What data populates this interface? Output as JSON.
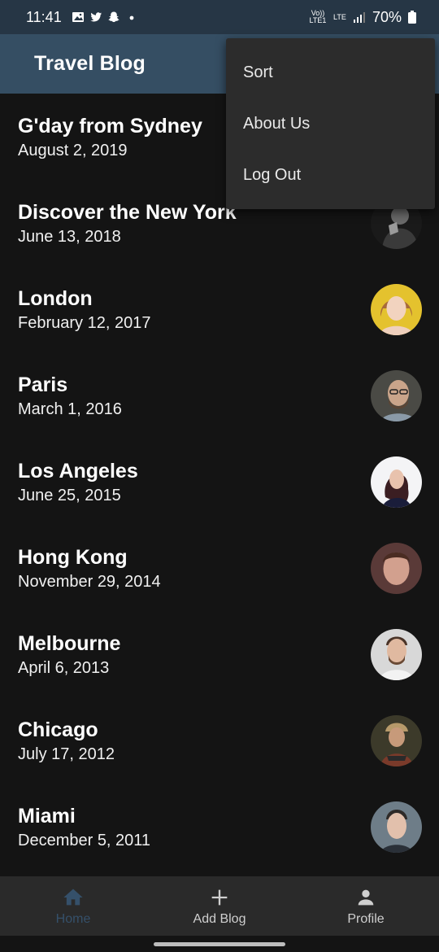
{
  "status_bar": {
    "time": "11:41",
    "battery": "70%",
    "network_volte": "Vo)) LTE1",
    "network_lte": "LTE",
    "notification_icons": [
      "gallery-icon",
      "twitter-icon",
      "snapchat-icon",
      "dot-icon"
    ]
  },
  "app_bar": {
    "title": "Travel Blog"
  },
  "menu": {
    "items": [
      {
        "label": "Sort"
      },
      {
        "label": "About Us"
      },
      {
        "label": "Log Out"
      }
    ]
  },
  "blogs": [
    {
      "title": "G'day from Sydney",
      "date": "August 2, 2019"
    },
    {
      "title": "Discover the New York",
      "date": "June 13, 2018"
    },
    {
      "title": "London",
      "date": "February 12, 2017"
    },
    {
      "title": "Paris",
      "date": "March 1, 2016"
    },
    {
      "title": "Los Angeles",
      "date": "June 25, 2015"
    },
    {
      "title": "Hong Kong",
      "date": "November 29, 2014"
    },
    {
      "title": "Melbourne",
      "date": "April 6, 2013"
    },
    {
      "title": "Chicago",
      "date": "July 17, 2012"
    },
    {
      "title": "Miami",
      "date": "December 5, 2011"
    }
  ],
  "bottom_nav": [
    {
      "label": "Home",
      "icon": "home-icon",
      "active": true
    },
    {
      "label": "Add Blog",
      "icon": "plus-icon",
      "active": false
    },
    {
      "label": "Profile",
      "icon": "person-icon",
      "active": false
    }
  ],
  "colors": {
    "status_bar": "#263645",
    "app_bar": "#354e63",
    "background": "#141414",
    "menu": "#2c2c2c",
    "nav_active": "#35506a",
    "bottom_nav": "#2a2a2a"
  }
}
